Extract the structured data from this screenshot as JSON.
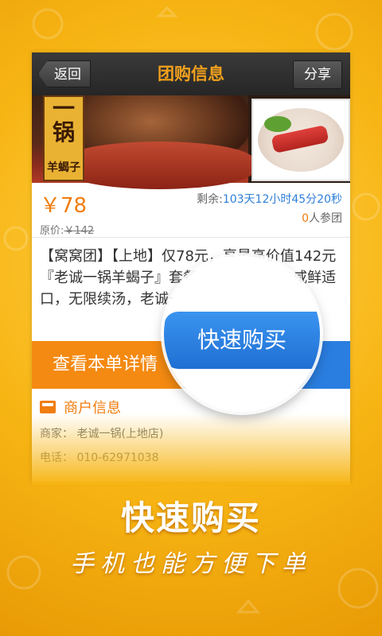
{
  "header": {
    "back_label": "返回",
    "title": "团购信息",
    "share_label": "分享"
  },
  "images": {
    "sign_big": "一\n锅",
    "sign_small": "羊蝎子"
  },
  "deal": {
    "price": "￥78",
    "original_label": "原价:",
    "original_price": "￥142",
    "remaining_label": "剩余:",
    "remaining_time": "103天12小时45分20秒",
    "joined_count": "0",
    "joined_label": "人参团",
    "description": "【窝窝团】【上地】仅78元，享最高价值142元『老诚一锅羊蝎子』套餐，双人餐3选1!咸鲜适口，无限续汤，老诚一锅羊蝎子!"
  },
  "actions": {
    "detail_label": "查看本单详情",
    "buy_label": "快速购买"
  },
  "merchant": {
    "header": "商户信息",
    "shop_line": "商家： 老诚一锅(上地店)",
    "phone_line": "电话： 010-62971038"
  },
  "promo": {
    "headline": "快速购买",
    "subline": "手机也能方便下单"
  },
  "colors": {
    "accent_orange": "#f07d0f",
    "button_blue": "#2a7ee0",
    "background_yellow": "#f7b514"
  }
}
